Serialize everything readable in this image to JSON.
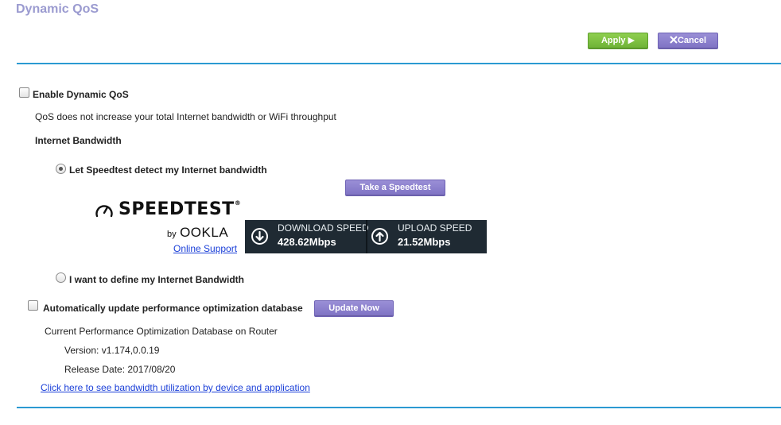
{
  "page": {
    "title": "Dynamic QoS"
  },
  "toolbar": {
    "apply_label": "Apply ▶",
    "cancel_label": "Cancel",
    "cancel_icon": "close-icon"
  },
  "qos": {
    "enable_label": "Enable Dynamic QoS",
    "enable_checked": false,
    "note": "QoS does not increase your total Internet bandwidth or WiFi throughput",
    "bandwidth_heading": "Internet Bandwidth",
    "speedtest_option_label": "Let Speedtest detect my Internet bandwidth",
    "speedtest_option_selected": true,
    "take_speedtest_label": "Take a Speedtest",
    "manual_option_label": "I want to define my Internet Bandwidth",
    "manual_option_selected": false
  },
  "speedtest": {
    "brand": "SPEEDTEST",
    "trademark": "®",
    "by": "by",
    "ookla": "OOKLA",
    "online_support": "Online Support",
    "download_title": "DOWNLOAD SPEED",
    "download_value": "428.62Mbps",
    "upload_title": "UPLOAD SPEED",
    "upload_value": "21.52Mbps"
  },
  "database": {
    "auto_update_label": "Automatically update performance optimization database",
    "auto_update_checked": false,
    "update_now_label": "Update Now",
    "current_label": "Current Performance Optimization Database on Router",
    "version": "Version: v1.174,0.0.19",
    "release_date": "Release Date: 2017/08/20",
    "utilization_link": "Click here to see bandwidth utilization by device and application"
  },
  "colors": {
    "accent_line": "#2b9ad2",
    "apply_green": "#7ac143",
    "button_purple": "#8378cc",
    "title_lavender": "#9b9bd0",
    "link_blue": "#1a3fd8",
    "speed_panel": "#1f2a33"
  }
}
